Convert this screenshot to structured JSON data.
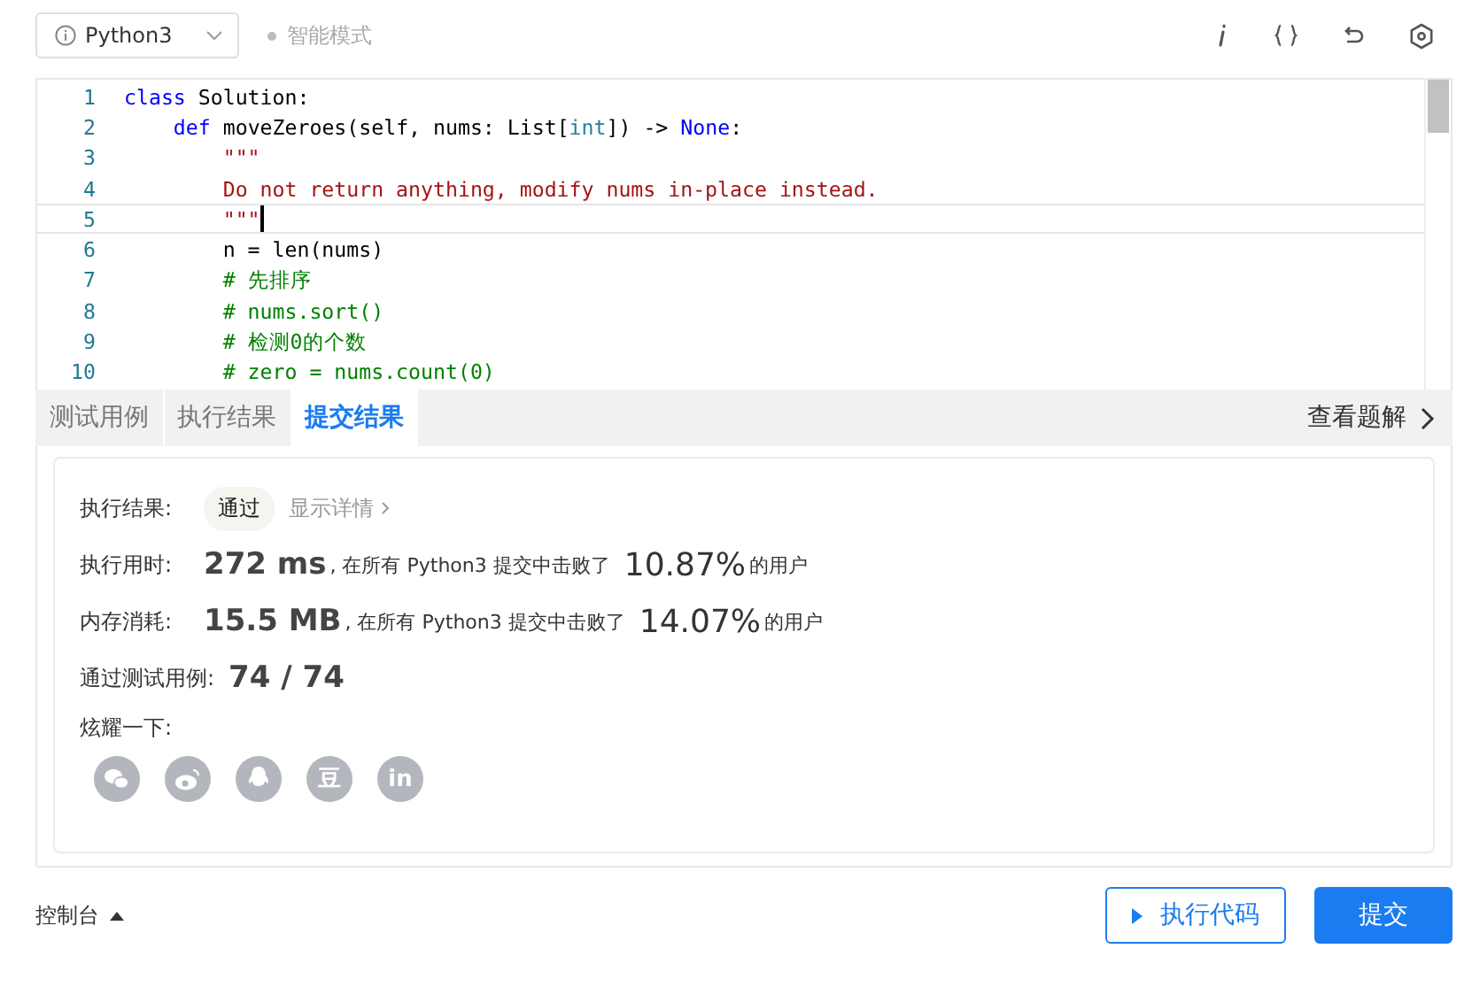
{
  "toolbar": {
    "language": "Python3",
    "mode": "智能模式"
  },
  "editor": {
    "lines": [
      {
        "number": "1",
        "current": false,
        "tokens": [
          {
            "kind": "keyword",
            "text": "class"
          },
          {
            "kind": "plain",
            "text": " Solution:"
          }
        ]
      },
      {
        "number": "2",
        "current": false,
        "tokens": [
          {
            "kind": "keyword",
            "text": "    def"
          },
          {
            "kind": "plain",
            "text": " moveZeroes(self, nums: List["
          },
          {
            "kind": "type",
            "text": "int"
          },
          {
            "kind": "plain",
            "text": "]) -> "
          },
          {
            "kind": "keyword",
            "text": "None"
          },
          {
            "kind": "plain",
            "text": ":"
          }
        ]
      },
      {
        "number": "3",
        "current": false,
        "tokens": [
          {
            "kind": "string",
            "text": "        \"\"\""
          }
        ]
      },
      {
        "number": "4",
        "current": false,
        "tokens": [
          {
            "kind": "string",
            "text": "        Do not return anything, modify nums in-place instead."
          }
        ]
      },
      {
        "number": "5",
        "current": true,
        "tokens": [
          {
            "kind": "string",
            "text": "        \"\"\""
          }
        ]
      },
      {
        "number": "6",
        "current": false,
        "tokens": [
          {
            "kind": "plain",
            "text": "        n = len(nums)"
          }
        ]
      },
      {
        "number": "7",
        "current": false,
        "tokens": [
          {
            "kind": "comment",
            "text": "        # 先排序"
          }
        ]
      },
      {
        "number": "8",
        "current": false,
        "tokens": [
          {
            "kind": "comment",
            "text": "        # nums.sort()"
          }
        ]
      },
      {
        "number": "9",
        "current": false,
        "tokens": [
          {
            "kind": "comment",
            "text": "        # 检测0的个数"
          }
        ]
      },
      {
        "number": "10",
        "current": false,
        "tokens": [
          {
            "kind": "comment",
            "text": "        # zero = nums.count(0)"
          }
        ]
      }
    ]
  },
  "tabs": [
    {
      "label": "测试用例",
      "selected": false
    },
    {
      "label": "执行结果",
      "selected": false
    },
    {
      "label": "提交结果",
      "selected": true
    }
  ],
  "solutions_link": "查看题解",
  "result": {
    "status_label": "执行结果:",
    "status": "通过",
    "details_link": "显示详情",
    "stats": [
      {
        "label": "执行用时:",
        "value": "272 ms",
        "middle": ", 在所有 Python3 提交中击败了",
        "percent": "10.87%",
        "suffix": "的用户"
      },
      {
        "label": "内存消耗:",
        "value": "15.5 MB",
        "middle": ", 在所有 Python3 提交中击败了",
        "percent": "14.07%",
        "suffix": "的用户"
      }
    ],
    "tests_label": "通过测试用例:",
    "tests_value": "74 / 74",
    "share_label": "炫耀一下:",
    "share": [
      {
        "kind": "wechat"
      },
      {
        "kind": "weibo"
      },
      {
        "kind": "qq"
      },
      {
        "kind": "text",
        "label": "豆"
      },
      {
        "kind": "text",
        "label": "in"
      }
    ]
  },
  "footer": {
    "console": "控制台",
    "run": "执行代码",
    "submit": "提交"
  }
}
